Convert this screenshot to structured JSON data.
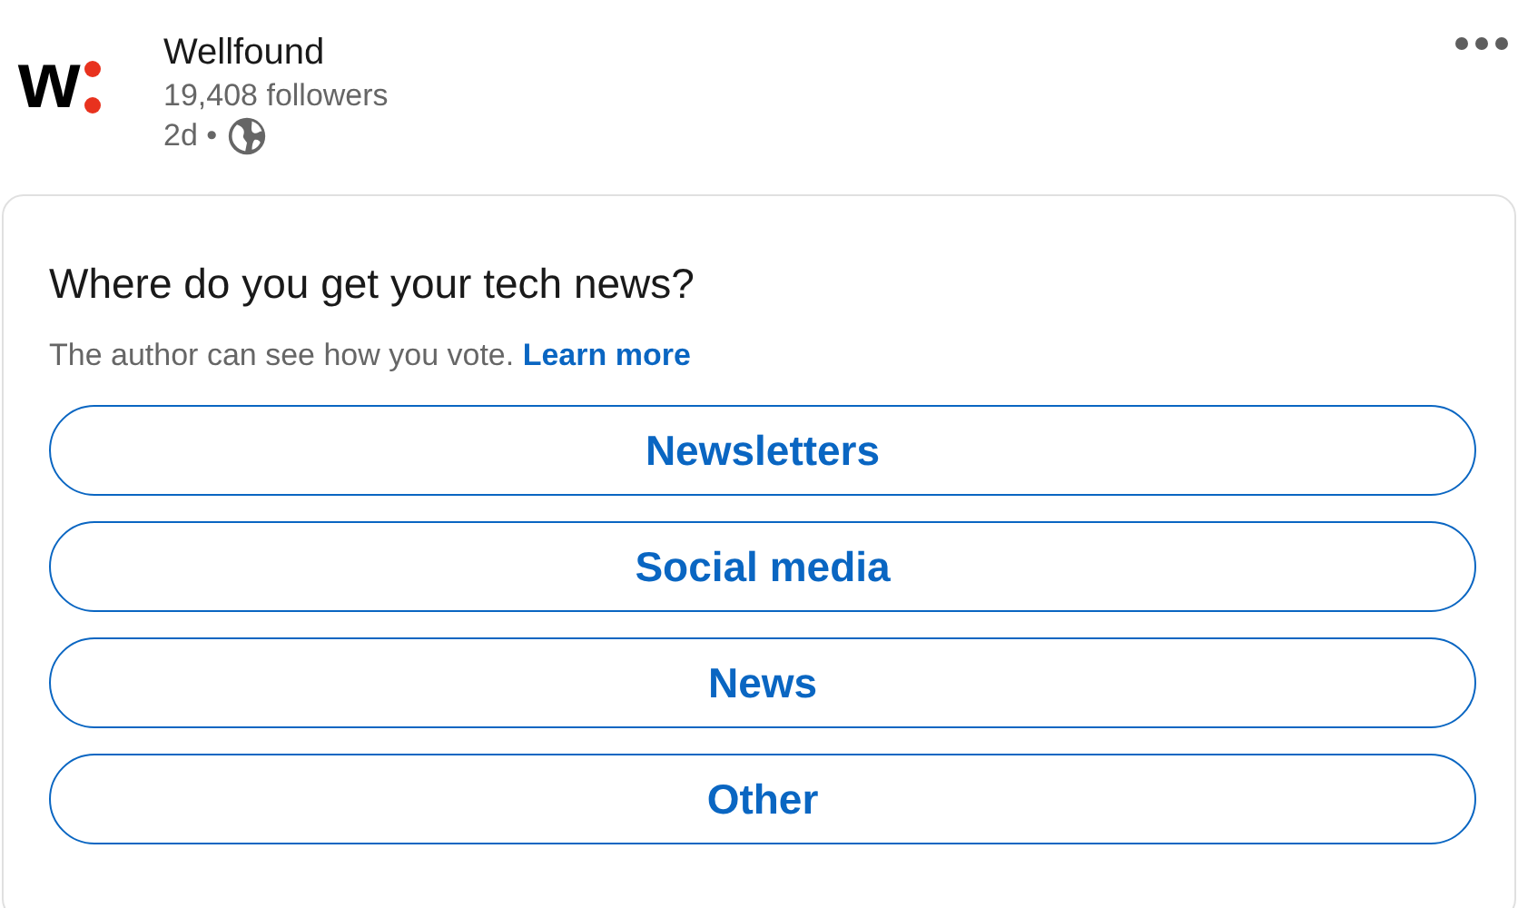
{
  "author": {
    "logo_text": "w",
    "name": "Wellfound",
    "followers": "19,408 followers",
    "age": "2d •"
  },
  "poll": {
    "question": "Where do you get your tech news?",
    "note": "The author can see how you vote.",
    "link": "Learn more",
    "options": [
      "Newsletters",
      "Social media",
      "News",
      "Other"
    ]
  }
}
